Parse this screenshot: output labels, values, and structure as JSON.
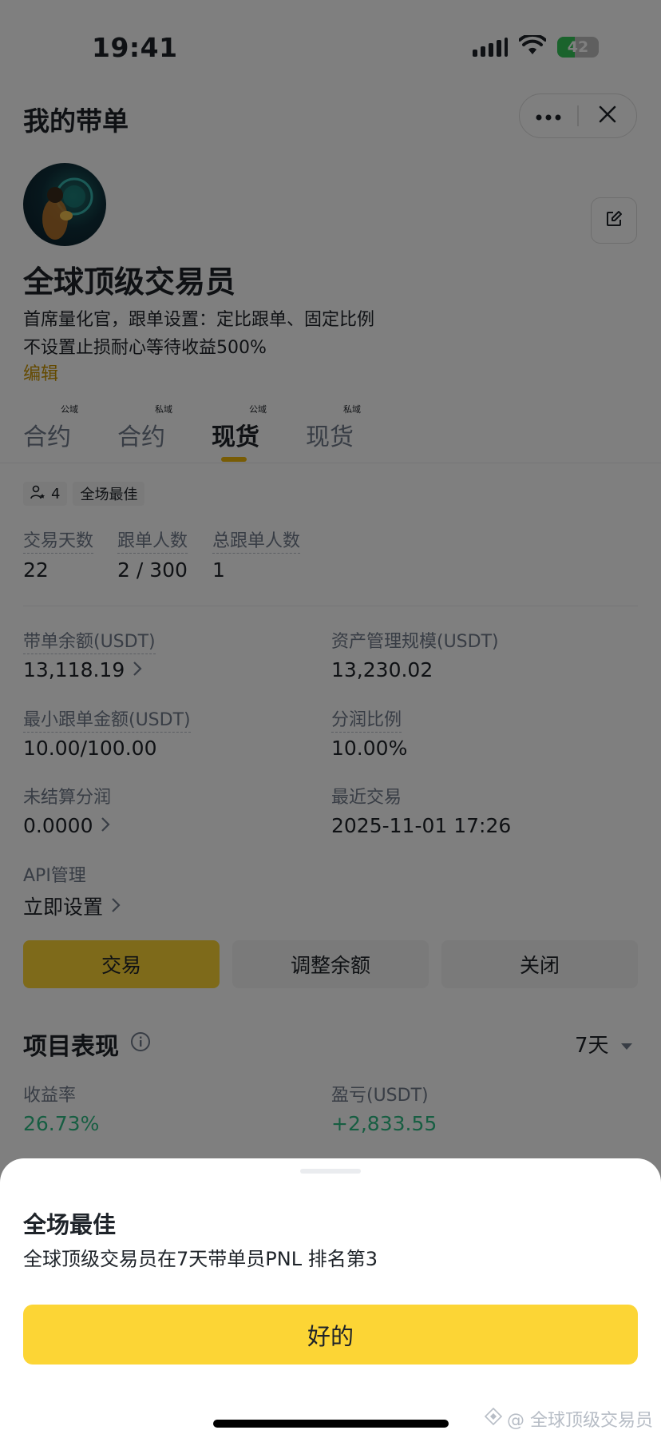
{
  "status_bar": {
    "time": "19:41",
    "battery": "42",
    "battery_level": 0.42,
    "colors": {
      "battery_fill": "#34c759"
    }
  },
  "header": {
    "title": "我的带单",
    "more_icon": "more-dots-icon",
    "close_icon": "close-icon"
  },
  "profile": {
    "name": "全球顶级交易员",
    "description_line1": "首席量化官，跟单设置：定比跟单、固定比例",
    "description_line2": "不设置止损耐心等待收益500%",
    "edit_link": "编辑"
  },
  "tabs": [
    {
      "label": "合约",
      "badge": "公域",
      "active": false
    },
    {
      "label": "合约",
      "badge": "私域",
      "active": false
    },
    {
      "label": "现货",
      "badge": "公域",
      "active": true
    },
    {
      "label": "现货",
      "badge": "私域",
      "active": false
    }
  ],
  "chips": {
    "followers_count": "4",
    "best_label": "全场最佳"
  },
  "stats": {
    "trading_days_label": "交易天数",
    "trading_days": "22",
    "copiers_label": "跟单人数",
    "copiers": "2 / 300",
    "total_copiers_label": "总跟单人数",
    "total_copiers": "1"
  },
  "balances": {
    "lead_balance_label": "带单余额(USDT)",
    "lead_balance": "13,118.19",
    "aum_label": "资产管理规模(USDT)",
    "aum": "13,230.02",
    "min_copy_label": "最小跟单金额(USDT)",
    "min_copy": "10.00/100.00",
    "profit_share_label": "分润比例",
    "profit_share": "10.00%",
    "unsettled_label": "未结算分润",
    "unsettled": "0.0000",
    "recent_trade_label": "最近交易",
    "recent_trade": "2025-11-01 17:26",
    "api_label": "API管理",
    "api_action": "立即设置"
  },
  "actions": {
    "trade": "交易",
    "adjust": "调整余额",
    "close": "关闭"
  },
  "performance": {
    "title": "项目表现",
    "period": "7天",
    "roi_label": "收益率",
    "roi": "26.73%",
    "pnl_label": "盈亏(USDT)",
    "pnl": "+2,833.55"
  },
  "sheet": {
    "title": "全场最佳",
    "text": "全球顶级交易员在7天带单员PNL 排名第3",
    "ok": "好的"
  },
  "watermark": "@ 全球顶级交易员",
  "colors": {
    "accent": "#fcd535",
    "link": "#c99400",
    "positive": "#2ebd85",
    "tab_indicator": "#f0b90b"
  }
}
